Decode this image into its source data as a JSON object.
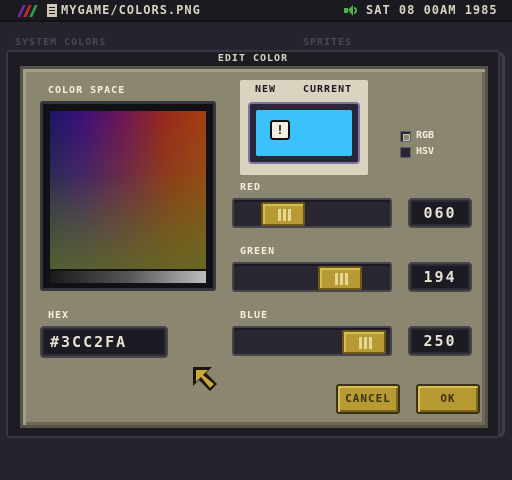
{
  "menubar": {
    "file_path": "MYGAME/COLORS.PNG",
    "datetime": "SAT 08 00AM 1985",
    "logo_colors": [
      "#6b2fa0",
      "#c02a2a",
      "#2e9b4a"
    ]
  },
  "background": {
    "left_window_label": "SYSTEM COLORS",
    "right_window_label": "SPRITES"
  },
  "dialog": {
    "title": "EDIT COLOR",
    "color_space_label": "COLOR SPACE",
    "preview": {
      "new_label": "NEW",
      "current_label": "CURRENT",
      "color": "#3CC2FA",
      "warning_glyph": "!"
    },
    "modes": [
      {
        "label": "RGB",
        "selected": true
      },
      {
        "label": "HSV",
        "selected": false
      }
    ],
    "channels": [
      {
        "key": "red",
        "label": "RED",
        "value": "060",
        "fraction": 0.235
      },
      {
        "key": "green",
        "label": "GREEN",
        "value": "194",
        "fraction": 0.761
      },
      {
        "key": "blue",
        "label": "BLUE",
        "value": "250",
        "fraction": 0.98
      }
    ],
    "hex_label": "HEX",
    "hex_value": "#3CC2FA",
    "cancel_label": "CANCEL",
    "ok_label": "OK"
  },
  "colors": {
    "button": "#B89A34",
    "panel": "#8B8670",
    "desktop": "#26232E"
  }
}
